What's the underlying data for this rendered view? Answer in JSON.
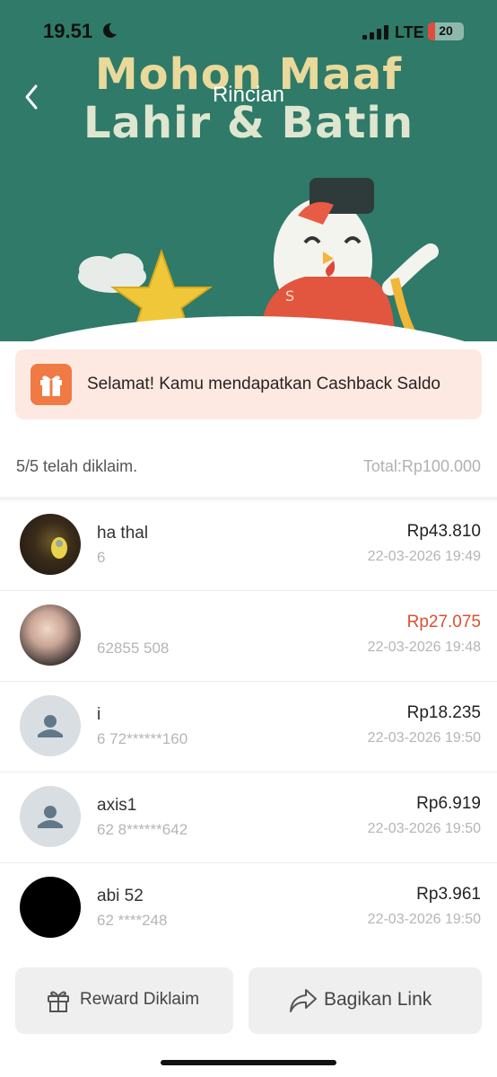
{
  "status_bar": {
    "time": "19.51",
    "network": "LTE",
    "battery": "20"
  },
  "banner": {
    "headline_line1": "Mohon Maaf",
    "headline_line2": "Lahir & Batin",
    "mascot_letter": "S"
  },
  "nav": {
    "title": "Rincian"
  },
  "notice": {
    "text": "Selamat! Kamu mendapatkan Cashback Saldo"
  },
  "summary": {
    "claimed": "5/5 telah diklaim.",
    "total": "Total:Rp100.000"
  },
  "claims": [
    {
      "name": "ha          thal",
      "phone": "6",
      "amount": "Rp43.810",
      "date": "22-03-2026 19:49",
      "highlight": false
    },
    {
      "name": "",
      "phone": "62855          508",
      "amount": "Rp27.075",
      "date": "22-03-2026 19:48",
      "highlight": true
    },
    {
      "name": "i",
      "phone": "6    72******160",
      "amount": "Rp18.235",
      "date": "22-03-2026 19:50",
      "highlight": false
    },
    {
      "name": "axis1",
      "phone": "62    8******642",
      "amount": "Rp6.919",
      "date": "22-03-2026 19:50",
      "highlight": false
    },
    {
      "name": "abi      52",
      "phone": "62    ****248",
      "amount": "Rp3.961",
      "date": "22-03-2026 19:50",
      "highlight": false
    }
  ],
  "buttons": {
    "reward": "Reward Diklaim",
    "share": "Bagikan Link"
  },
  "colors": {
    "banner": "#2f7a68",
    "accent": "#f07a44",
    "highlight_amount": "#d9502f",
    "notice_bg": "#fde9e1"
  },
  "icons": {
    "notice": "gift-icon",
    "reward": "gift-icon",
    "share": "share-arrow-icon",
    "back": "chevron-left-icon"
  }
}
